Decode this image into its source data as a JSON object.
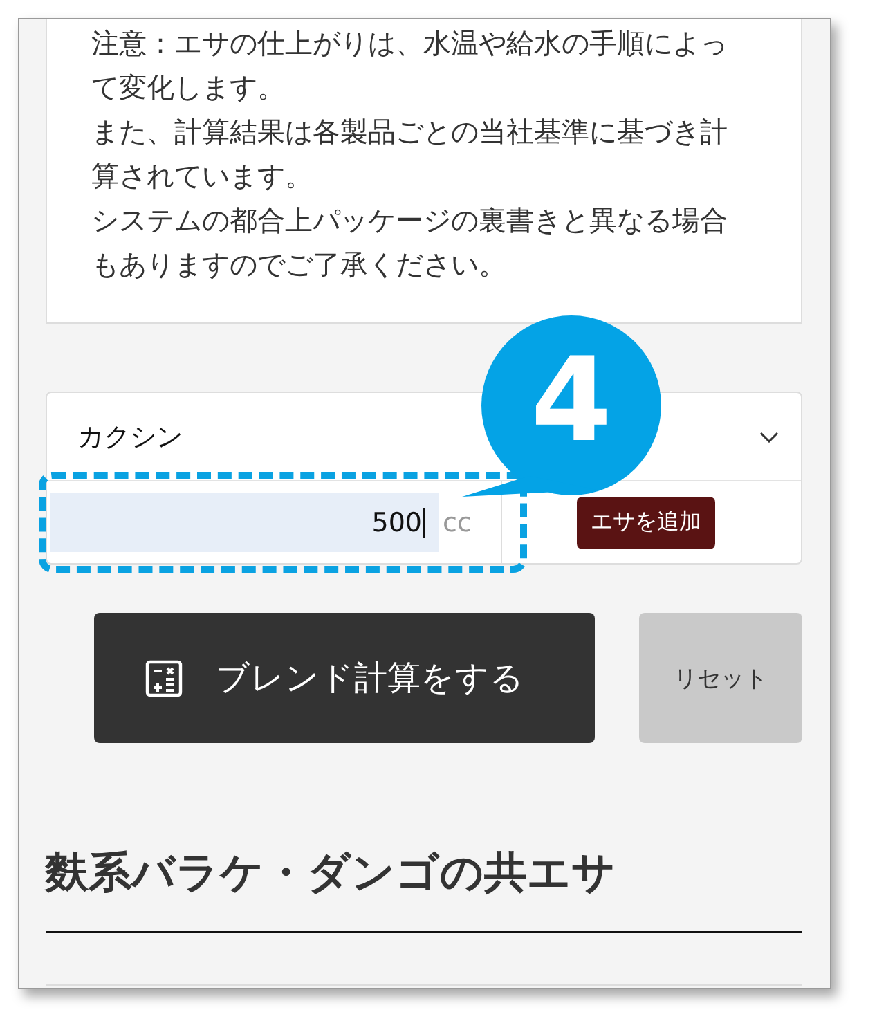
{
  "notice": {
    "paragraphs": [
      "注意：エサの仕上がりは、水温や給水の手順によって変化します。",
      "また、計算結果は各製品ごとの当社基準に基づき計算されています。",
      "システムの都合上パッケージの裏書きと異なる場合もありますのでご了承ください。"
    ]
  },
  "feed_row": {
    "select_value": "カクシン",
    "amount": "500",
    "unit": "cc",
    "add_button": "エサを追加"
  },
  "actions": {
    "calculate_button": "ブレンド計算をする",
    "reset_button": "リセット"
  },
  "heading": "麩系バラケ・ダンゴの共エサ",
  "callout": {
    "number": "4"
  }
}
